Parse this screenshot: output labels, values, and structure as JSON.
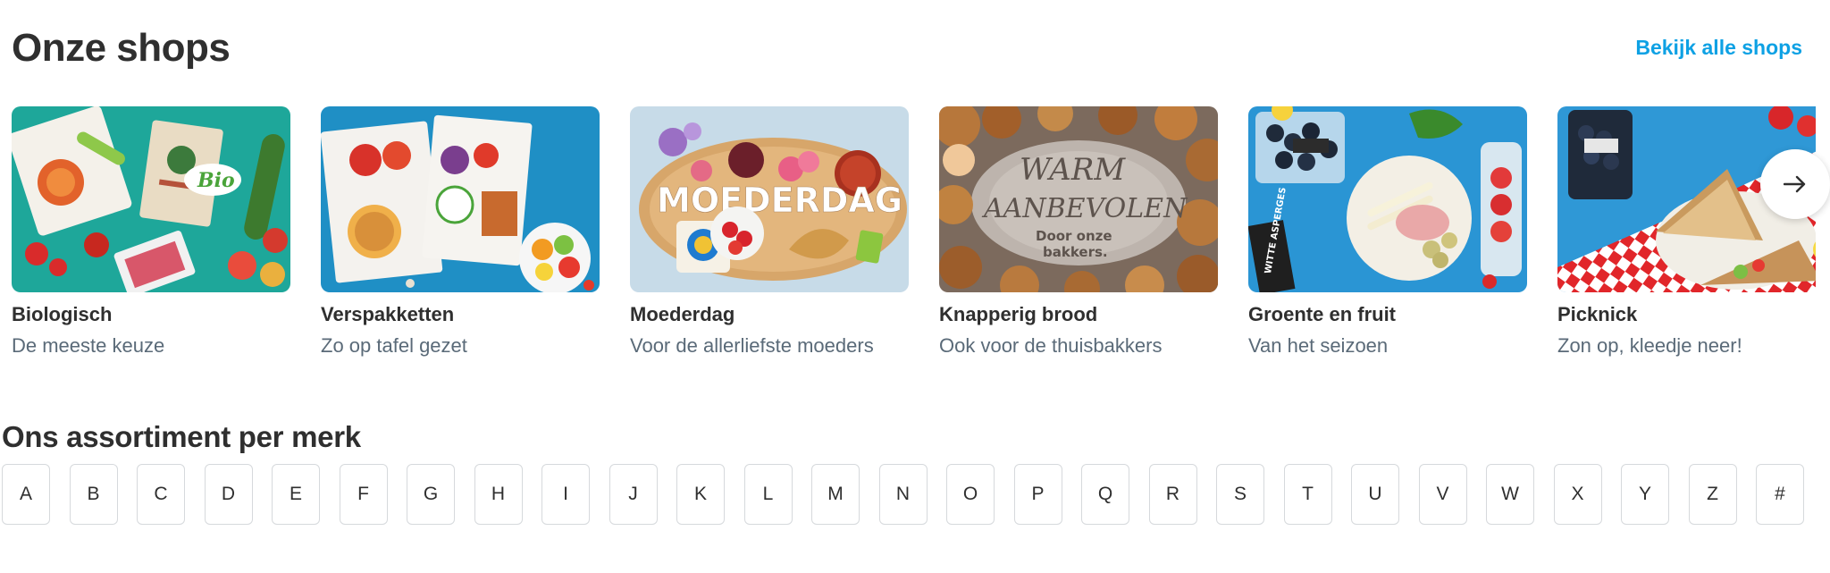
{
  "shops": {
    "title": "Onze shops",
    "view_all_label": "Bekijk alle shops",
    "next_icon": "arrow-right-icon",
    "cards": [
      {
        "title": "Biologisch",
        "subtitle": "De meeste keuze",
        "image_bg": "#1ea79a",
        "image_text": "Bio"
      },
      {
        "title": "Verspakketten",
        "subtitle": "Zo op tafel gezet",
        "image_bg": "#1f8fc5",
        "image_text": ""
      },
      {
        "title": "Moederdag",
        "subtitle": "Voor de allerliefste moeders",
        "image_bg": "#c7dbe8",
        "image_text": "MOEDERDAG"
      },
      {
        "title": "Knapperig brood",
        "subtitle": "Ook voor de thuisbakkers",
        "image_bg": "#7c6a5d",
        "image_text": "WARM AANBEVOLEN",
        "image_subtext": "Door onze bakkers."
      },
      {
        "title": "Groente en fruit",
        "subtitle": "Van het seizoen",
        "image_bg": "#2a95d4",
        "image_text": "WITTE ASPERGES"
      },
      {
        "title": "Picknick",
        "subtitle": "Zon op, kleedje neer!",
        "image_bg": "#2f98d6",
        "image_text": ""
      }
    ]
  },
  "brands": {
    "title": "Ons assortiment per merk",
    "letters": [
      "A",
      "B",
      "C",
      "D",
      "E",
      "F",
      "G",
      "H",
      "I",
      "J",
      "K",
      "L",
      "M",
      "N",
      "O",
      "P",
      "Q",
      "R",
      "S",
      "T",
      "U",
      "V",
      "W",
      "X",
      "Y",
      "Z",
      "#"
    ]
  },
  "colors": {
    "accent": "#0ea1e4",
    "text": "#2f2f2f",
    "muted": "#5a6a78",
    "border": "#d6d9dc"
  }
}
